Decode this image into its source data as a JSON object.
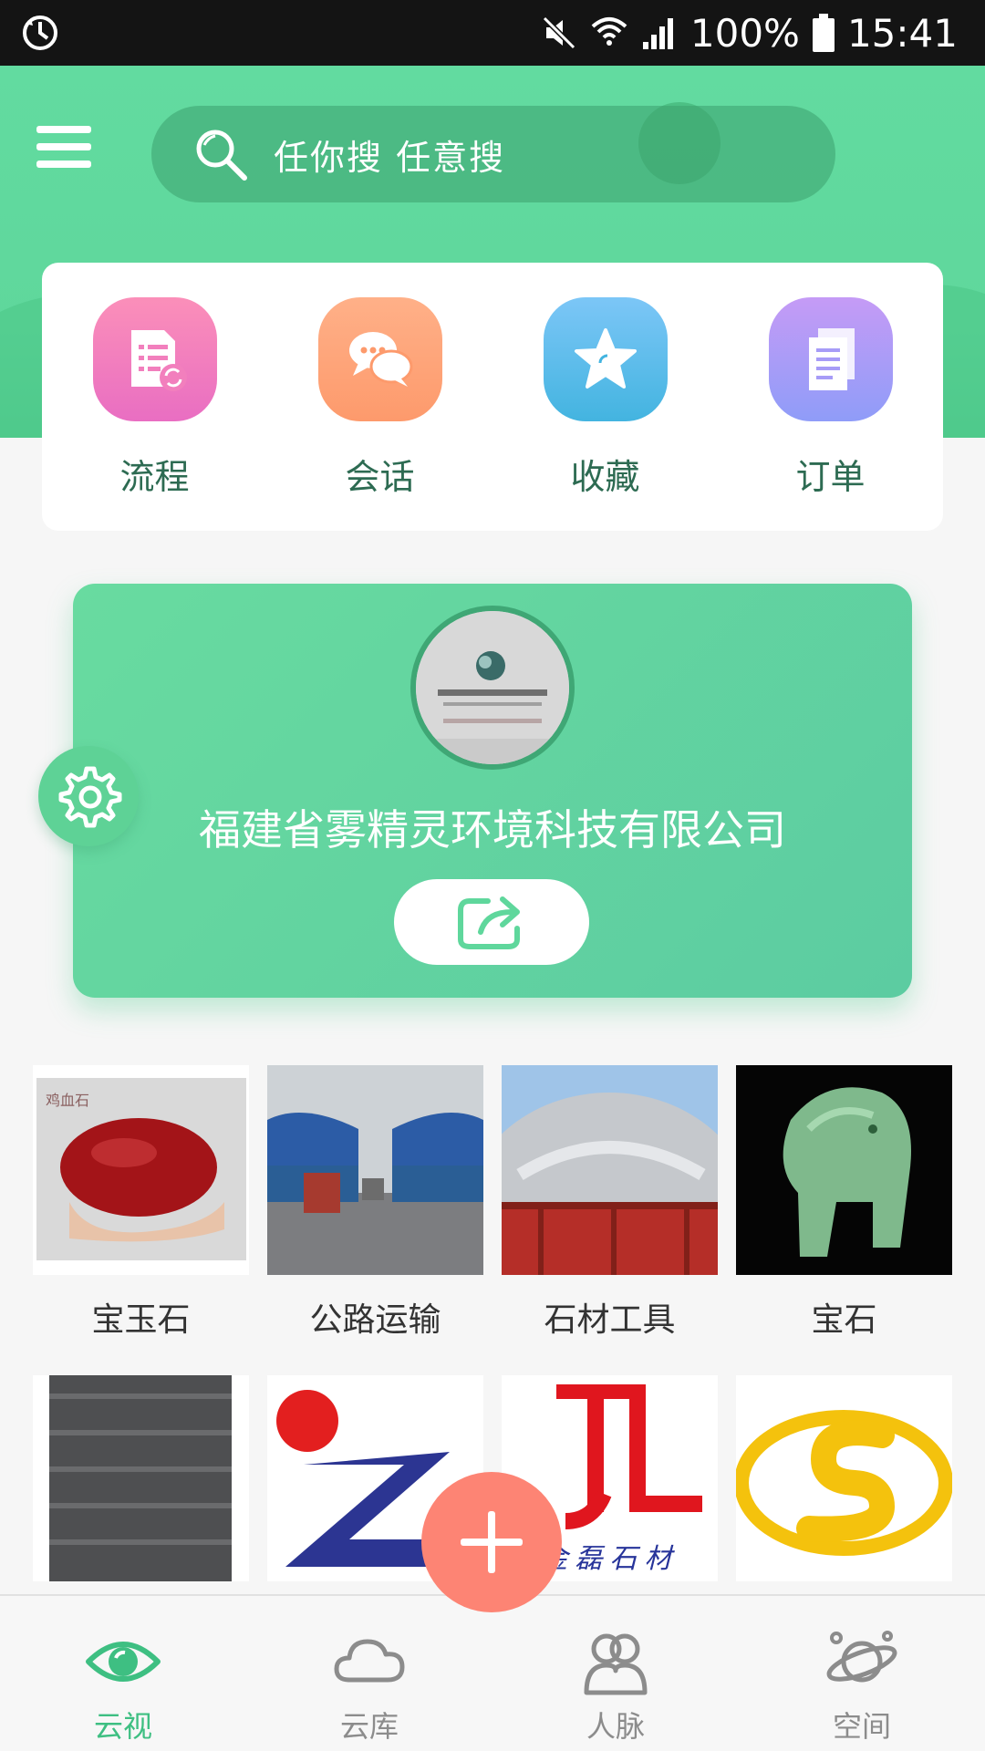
{
  "status_bar": {
    "battery": "100%",
    "time": "15:41"
  },
  "header": {
    "search_placeholder": "任你搜   任意搜"
  },
  "shortcuts": [
    {
      "label": "流程",
      "icon": "process-doc-icon"
    },
    {
      "label": "会话",
      "icon": "chat-bubbles-icon"
    },
    {
      "label": "收藏",
      "icon": "star-icon"
    },
    {
      "label": "订单",
      "icon": "order-doc-icon"
    }
  ],
  "profile": {
    "company_name": "福建省雾精灵环境科技有限公司"
  },
  "categories": [
    {
      "label": "宝玉石"
    },
    {
      "label": "公路运输"
    },
    {
      "label": "石材工具"
    },
    {
      "label": "宝石"
    }
  ],
  "brand_tiles": [
    {
      "label": ""
    },
    {
      "label": ""
    },
    {
      "label": "金磊石材"
    },
    {
      "label": ""
    }
  ],
  "bottom_nav": [
    {
      "label": "云视",
      "icon": "eye-icon",
      "active": true
    },
    {
      "label": "云库",
      "icon": "cloud-icon"
    },
    {
      "label": "人脉",
      "icon": "people-icon"
    },
    {
      "label": "空间",
      "icon": "planet-icon"
    }
  ],
  "colors": {
    "accent": "#5fd79c",
    "fab": "#fd8474",
    "nav_active": "#3ebf82"
  }
}
